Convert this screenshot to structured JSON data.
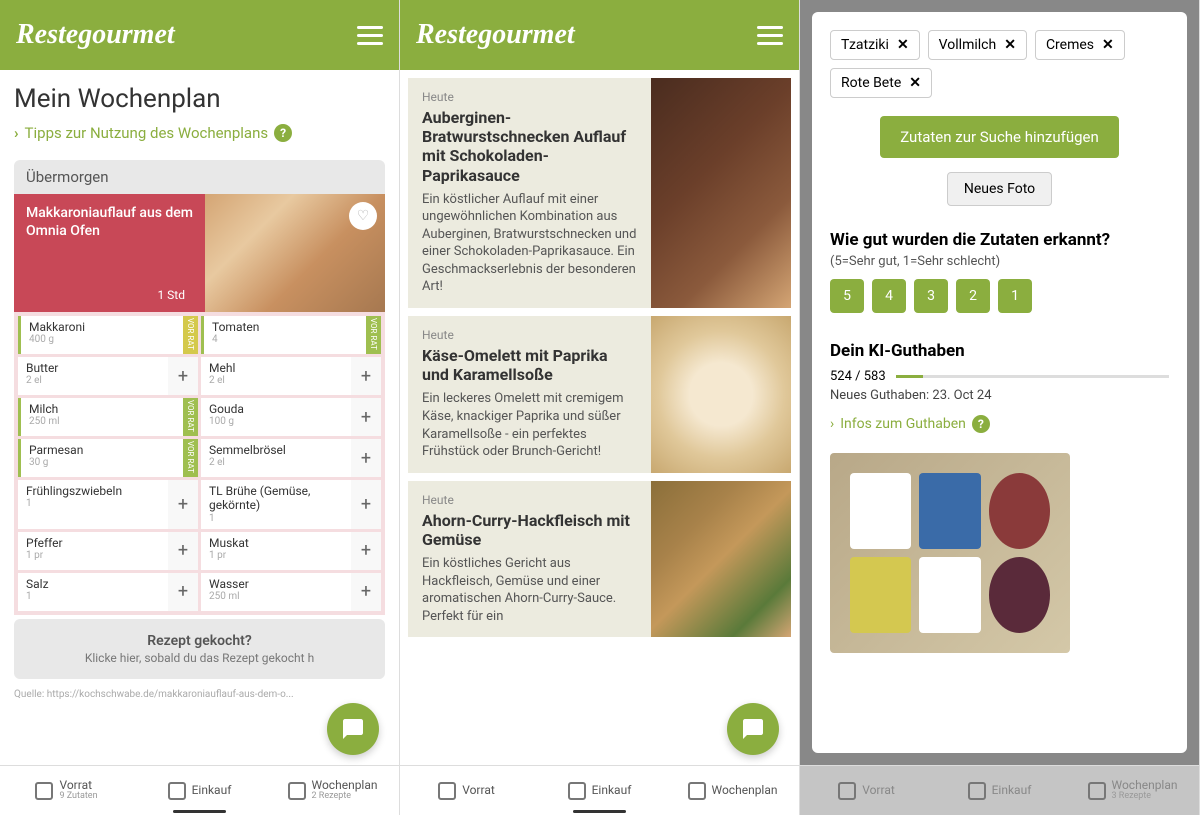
{
  "brand": "Restegourmet",
  "screen1": {
    "title": "Mein Wochenplan",
    "tipsLink": "Tipps zur Nutzung des Wochenplans",
    "dayLabel": "Übermorgen",
    "recipeTitle": "Makkaroniauflauf aus dem Omnia Ofen",
    "recipeTime": "1 Std",
    "ingredients": [
      [
        {
          "name": "Makkaroni",
          "amt": "400 g",
          "badge": "VOR RAT",
          "badgeColor": "yellow",
          "bar": true
        },
        {
          "name": "Tomaten",
          "amt": "4",
          "badge": "VOR RAT",
          "bar": true
        }
      ],
      [
        {
          "name": "Butter",
          "amt": "2 el",
          "plus": true
        },
        {
          "name": "Mehl",
          "amt": "2 el",
          "plus": true
        }
      ],
      [
        {
          "name": "Milch",
          "amt": "250 ml",
          "badge": "VOR RAT",
          "bar": true
        },
        {
          "name": "Gouda",
          "amt": "100 g",
          "plus": true
        }
      ],
      [
        {
          "name": "Parmesan",
          "amt": "30 g",
          "badge": "VOR RAT",
          "bar": true
        },
        {
          "name": "Semmelbrösel",
          "amt": "2 el",
          "plus": true
        }
      ],
      [
        {
          "name": "Frühlingszwiebeln",
          "amt": "1",
          "plus": true
        },
        {
          "name": "TL Brühe (Gemüse, gekörnte)",
          "amt": "1",
          "plus": true
        }
      ],
      [
        {
          "name": "Pfeffer",
          "amt": "1 pr",
          "plus": true
        },
        {
          "name": "Muskat",
          "amt": "1 pr",
          "plus": true
        }
      ],
      [
        {
          "name": "Salz",
          "amt": "1",
          "plus": true
        },
        {
          "name": "Wasser",
          "amt": "250 ml",
          "plus": true
        }
      ]
    ],
    "cookedTitle": "Rezept gekocht?",
    "cookedSub": "Klicke hier, sobald du das Rezept gekocht h",
    "source": "Quelle: https://kochschwabe.de/makkaroniauflauf-aus-dem-o..."
  },
  "tabs": {
    "vorrat": "Vorrat",
    "vorratSub": "9 Zutaten",
    "einkauf": "Einkauf",
    "wochenplan": "Wochenplan",
    "wochenplanSub": "2 Rezepte",
    "wochenplanSub3": "3 Rezepte"
  },
  "screen2": {
    "items": [
      {
        "day": "Heute",
        "title": "Auberginen-Bratwurstschnecken Auflauf mit Schokoladen-Paprikasauce",
        "desc": "Ein köstlicher Auflauf mit einer ungewöhnlichen Kombination aus Auberginen, Bratwurstschnecken und einer Schokoladen-Paprikasauce. Ein Geschmackserlebnis der besonderen Art!",
        "img": "rli1"
      },
      {
        "day": "Heute",
        "title": "Käse-Omelett mit Paprika und Karamellsoße",
        "desc": "Ein leckeres Omelett mit cremigem Käse, knackiger Paprika und süßer Karamellsoße - ein perfektes Frühstück oder Brunch-Gericht!",
        "img": "rli2"
      },
      {
        "day": "Heute",
        "title": "Ahorn-Curry-Hackfleisch mit Gemüse",
        "desc": "Ein köstliches Gericht aus Hackfleisch, Gemüse und einer aromatischen Ahorn-Curry-Sauce. Perfekt für ein",
        "img": "rli3"
      }
    ]
  },
  "screen3": {
    "tags": [
      "Tzatziki",
      "Vollmilch",
      "Cremes",
      "Rote Bete"
    ],
    "addBtn": "Zutaten zur Suche hinzufügen",
    "newPhoto": "Neues Foto",
    "question": "Wie gut wurden die Zutaten erkannt?",
    "scale": "(5=Sehr gut, 1=Sehr schlecht)",
    "ratings": [
      "5",
      "4",
      "3",
      "2",
      "1"
    ],
    "creditTitle": "Dein KI-Guthaben",
    "creditNum": "524 / 583",
    "creditDate": "Neues Guthaben: 23. Oct 24",
    "creditLink": "Infos zum Guthaben"
  }
}
